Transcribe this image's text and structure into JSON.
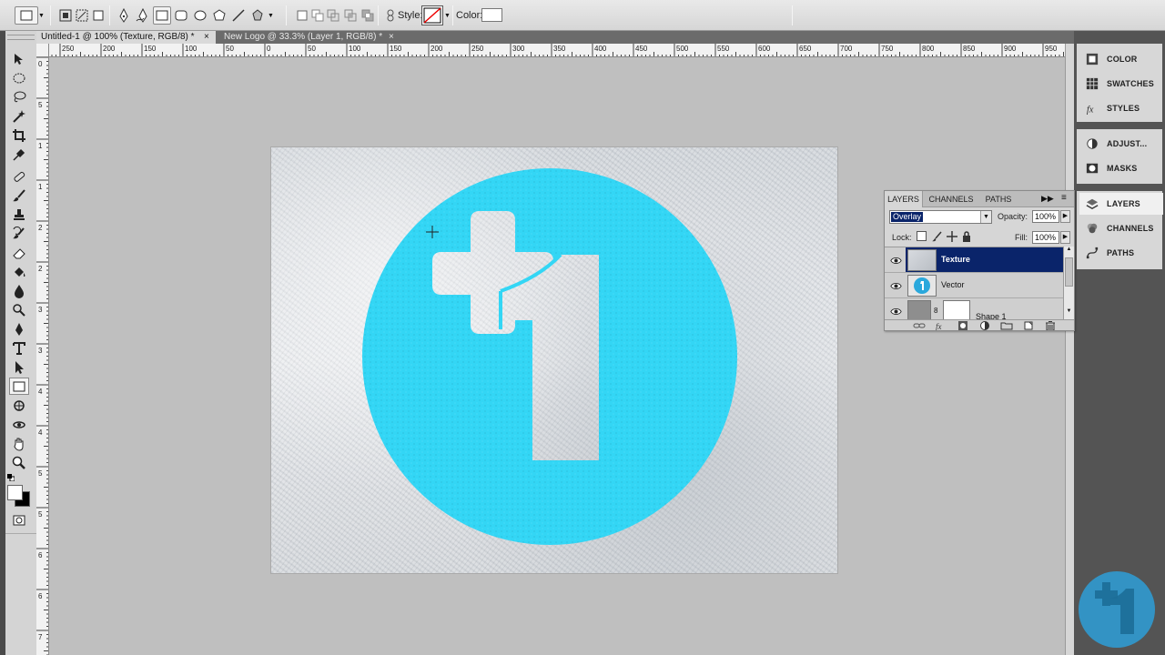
{
  "options_bar": {
    "style_label": "Style:",
    "color_label": "Color:",
    "color_swatch": "#ffffff"
  },
  "tabs": [
    {
      "label": "Untitled-1 @ 100% (Texture, RGB/8) *",
      "close": "×",
      "active": true
    },
    {
      "label": "New Logo @ 33.3% (Layer 1, RGB/8) *",
      "close": "×",
      "active": false
    }
  ],
  "ruler": {
    "top_ticks": [
      "250",
      "200",
      "150",
      "100",
      "50",
      "0",
      "50",
      "100",
      "150",
      "200",
      "250",
      "300",
      "350",
      "400",
      "450",
      "500",
      "550",
      "600",
      "650",
      "700",
      "750",
      "800",
      "850",
      "900",
      "950"
    ],
    "left_ticks": [
      "0",
      "5",
      "1",
      "1",
      "2",
      "2",
      "3",
      "3",
      "4",
      "4",
      "5",
      "5",
      "6",
      "6",
      "7",
      "7"
    ]
  },
  "dock": {
    "group1": [
      {
        "label": "COLOR",
        "icon": "color-icon"
      },
      {
        "label": "SWATCHES",
        "icon": "swatches-icon"
      },
      {
        "label": "STYLES",
        "icon": "styles-icon"
      }
    ],
    "group2": [
      {
        "label": "ADJUST...",
        "icon": "adjustments-icon"
      },
      {
        "label": "MASKS",
        "icon": "masks-icon"
      }
    ],
    "group3": [
      {
        "label": "LAYERS",
        "icon": "layers-icon"
      },
      {
        "label": "CHANNELS",
        "icon": "channels-icon"
      },
      {
        "label": "PATHS",
        "icon": "paths-icon"
      }
    ]
  },
  "layers_panel": {
    "tabs": [
      "LAYERS",
      "CHANNELS",
      "PATHS"
    ],
    "blend_mode": "Overlay",
    "opacity_label": "Opacity:",
    "opacity_value": "100%",
    "lock_label": "Lock:",
    "fill_label": "Fill:",
    "fill_value": "100%",
    "layers": [
      {
        "name": "Texture",
        "selected": true
      },
      {
        "name": "Vector",
        "selected": false
      },
      {
        "name": "Shape 1",
        "selected": false
      }
    ]
  },
  "colors": {
    "logo_cyan": "#33d6f5",
    "selection_blue": "#0a246a",
    "watermark": "#2e9fd8"
  }
}
